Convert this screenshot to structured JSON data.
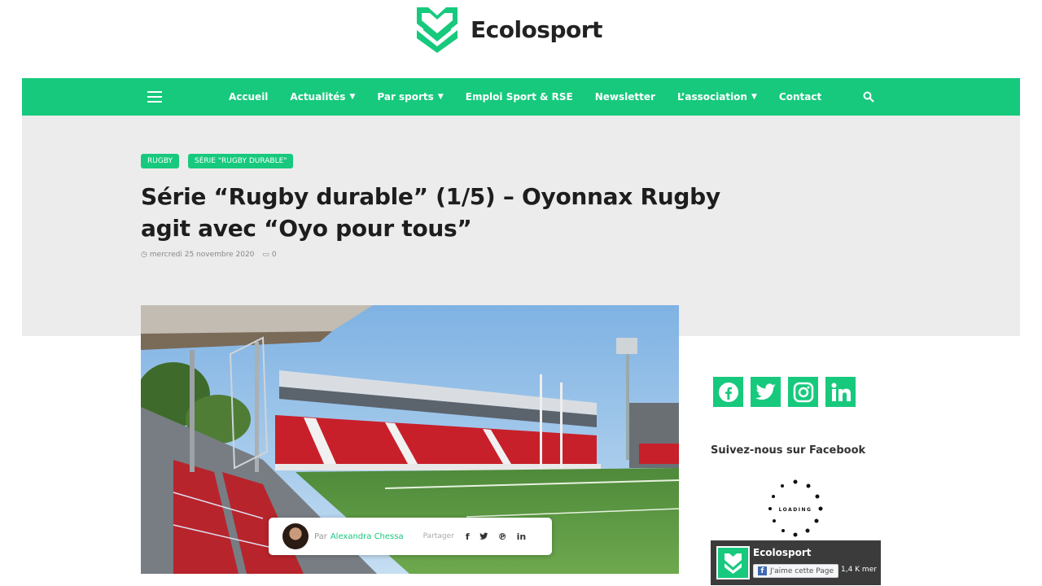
{
  "brand": {
    "name": "Ecolosport",
    "color": "#17c97d"
  },
  "nav": {
    "items": [
      {
        "label": "Accueil",
        "dropdown": false
      },
      {
        "label": "Actualités",
        "dropdown": true
      },
      {
        "label": "Par sports",
        "dropdown": true
      },
      {
        "label": "Emploi Sport & RSE",
        "dropdown": false
      },
      {
        "label": "Newsletter",
        "dropdown": false
      },
      {
        "label": "L’association",
        "dropdown": true
      },
      {
        "label": "Contact",
        "dropdown": false
      }
    ],
    "menu_icon": "hamburger-icon",
    "search_icon": "search-icon"
  },
  "article": {
    "tags": [
      "RUGBY",
      "SÉRIE \"RUGBY DURABLE\""
    ],
    "title": "Série “Rugby durable” (1/5) – Oyonnax Rugby agit avec “Oyo pour tous”",
    "date": "mercredi 25 novembre 2020",
    "comments": "0",
    "author": {
      "prefix": "Par",
      "name": "Alexandra Chessa"
    },
    "share_label": "Partager",
    "share_icons": [
      "facebook-icon",
      "twitter-icon",
      "pinterest-icon",
      "linkedin-icon"
    ]
  },
  "sidebar": {
    "social_icons": [
      "facebook-icon",
      "twitter-icon",
      "instagram-icon",
      "linkedin-icon"
    ],
    "follow_heading": "Suivez-nous sur Facebook",
    "loading_text": "LOADING",
    "fb_widget": {
      "page_name": "Ecolosport",
      "like_label": "J'aime cette Page",
      "count": "1,4 K mer"
    }
  }
}
